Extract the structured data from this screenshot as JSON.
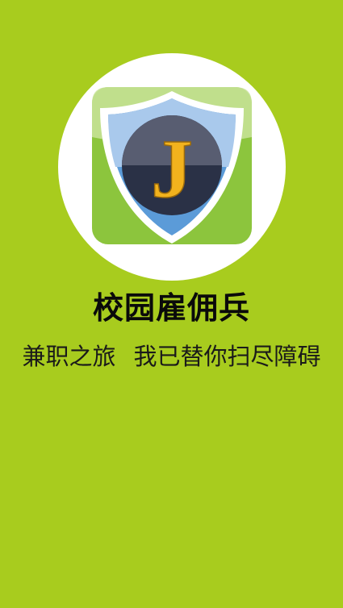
{
  "app": {
    "title": "校园雇佣兵",
    "slogan_part1": "兼职之旅",
    "slogan_part2": "我已替你扫尽障碍",
    "logo_letter": "J"
  },
  "theme": {
    "background": "#a8cc1e",
    "icon_green": "#8cc53d",
    "shield_blue": "#5b9bd8",
    "shield_light": "#a9c9ec",
    "emblem_dark": "#2a3146",
    "letter_gold": "#f2b21d"
  },
  "icons": {
    "logo": "shield-emblem-icon"
  }
}
